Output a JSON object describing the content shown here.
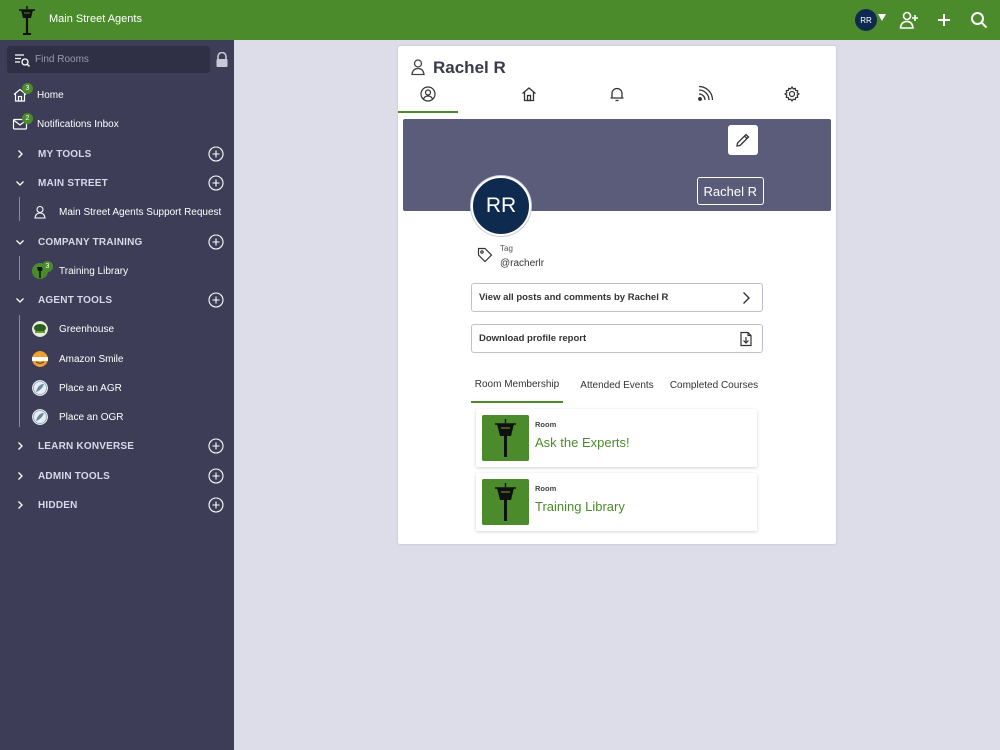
{
  "app": {
    "title": "Main Street Agents",
    "user_initials": "RR"
  },
  "colors": {
    "brand_green": "#4c8b2b",
    "sidebar": "#3d3d58",
    "banner": "#5b5b7a",
    "avatar": "#0f2a4f"
  },
  "topbar": {
    "icons": [
      "add-user-icon",
      "plus-icon",
      "search-icon"
    ]
  },
  "sidebar": {
    "search_placeholder": "Find Rooms",
    "home": {
      "label": "Home",
      "badge": "3"
    },
    "inbox": {
      "label": "Notifications Inbox",
      "badge": "2"
    },
    "sections": [
      {
        "label": "MY TOOLS",
        "expanded": false
      },
      {
        "label": "MAIN STREET",
        "expanded": true,
        "items": [
          {
            "label": "Main Street Agents Support Request"
          }
        ]
      },
      {
        "label": "COMPANY TRAINING",
        "expanded": true,
        "items": [
          {
            "label": "Training Library",
            "badge": "3"
          }
        ]
      },
      {
        "label": "AGENT TOOLS",
        "expanded": true,
        "items": [
          {
            "label": "Greenhouse"
          },
          {
            "label": "Amazon Smile"
          },
          {
            "label": "Place an AGR"
          },
          {
            "label": "Place an OGR"
          }
        ]
      },
      {
        "label": "LEARN KONVERSE",
        "expanded": false
      },
      {
        "label": "ADMIN TOOLS",
        "expanded": false
      },
      {
        "label": "HIDDEN",
        "expanded": false
      }
    ]
  },
  "profile": {
    "name": "Rachel R",
    "initials": "RR",
    "tabs": [
      "profile-icon",
      "home-icon",
      "bell-icon",
      "feed-icon",
      "gear-icon"
    ],
    "tag_label": "Tag",
    "tag_value": "@racherlr",
    "view_posts_label": "View all posts and comments by Rachel R",
    "download_label": "Download profile report",
    "subtabs": [
      "Room Membership",
      "Attended Events",
      "Completed Courses"
    ],
    "rooms": [
      {
        "type": "Room",
        "name": "Ask the Experts!"
      },
      {
        "type": "Room",
        "name": "Training Library"
      }
    ]
  }
}
